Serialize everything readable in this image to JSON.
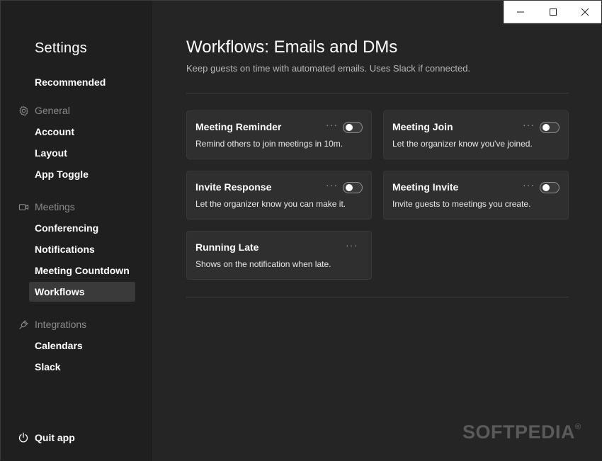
{
  "window": {
    "controls": {
      "minimize": "minimize",
      "maximize": "maximize",
      "close": "close"
    }
  },
  "sidebar": {
    "title": "Settings",
    "recommended": "Recommended",
    "sections": [
      {
        "label": "General",
        "icon": "gear-icon",
        "items": [
          "Account",
          "Layout",
          "App Toggle"
        ]
      },
      {
        "label": "Meetings",
        "icon": "video-icon",
        "items": [
          "Conferencing",
          "Notifications",
          "Meeting Countdown",
          "Workflows"
        ]
      },
      {
        "label": "Integrations",
        "icon": "plug-icon",
        "items": [
          "Calendars",
          "Slack"
        ]
      }
    ],
    "active_item": "Workflows",
    "quit_label": "Quit app"
  },
  "main": {
    "title": "Workflows: Emails and DMs",
    "subtitle": "Keep guests on time with automated emails. Uses Slack if connected.",
    "cards": [
      {
        "title": "Meeting Reminder",
        "description": "Remind others to join meetings in 10m.",
        "toggle": false
      },
      {
        "title": "Meeting Join",
        "description": "Let the organizer know you've joined.",
        "toggle": false
      },
      {
        "title": "Invite Response",
        "description": "Let the organizer know you can make it.",
        "toggle": false
      },
      {
        "title": "Meeting Invite",
        "description": "Invite guests to meetings you create.",
        "toggle": false
      },
      {
        "title": "Running Late",
        "description": "Shows on the notification when late."
      }
    ],
    "more_label": "···"
  },
  "watermark": {
    "text": "SOFTPEDIA",
    "mark": "®"
  },
  "colors": {
    "sidebar_bg": "#1f1f1f",
    "main_bg": "#252525",
    "card_bg": "#2f2f2f",
    "active_item_bg": "#3a3a3a"
  }
}
